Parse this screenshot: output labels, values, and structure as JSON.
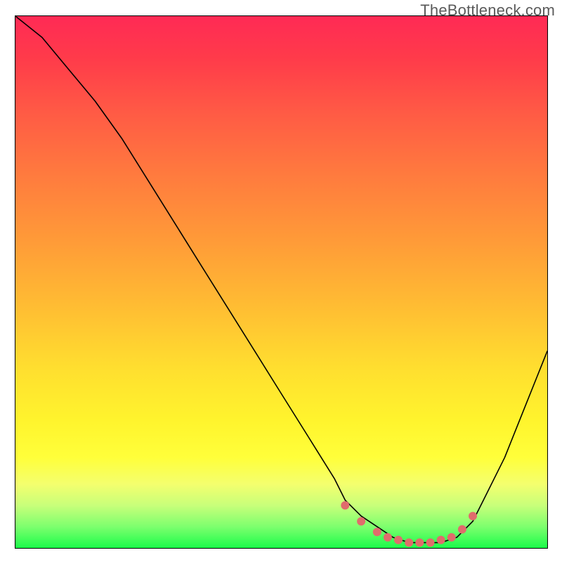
{
  "watermark": "TheBottleneck.com",
  "chart_data": {
    "type": "line",
    "title": "",
    "xlabel": "",
    "ylabel": "",
    "xlim": [
      0,
      100
    ],
    "ylim": [
      0,
      100
    ],
    "grid": false,
    "series": [
      {
        "name": "bottleneck-curve",
        "x": [
          0,
          5,
          10,
          15,
          20,
          25,
          30,
          35,
          40,
          45,
          50,
          55,
          60,
          62,
          65,
          68,
          71,
          74,
          77,
          80,
          83,
          86,
          88,
          92,
          96,
          100
        ],
        "y": [
          100,
          96,
          90,
          84,
          77,
          69,
          61,
          53,
          45,
          37,
          29,
          21,
          13,
          9,
          6,
          4,
          2,
          1,
          1,
          1,
          2,
          5,
          9,
          17,
          27,
          37
        ],
        "color": "#000000"
      }
    ],
    "markers": {
      "name": "optimal-zone-dots",
      "color": "#e06c6c",
      "x": [
        62,
        65,
        68,
        70,
        72,
        74,
        76,
        78,
        80,
        82,
        84,
        86
      ],
      "y": [
        8,
        5,
        3,
        2,
        1.5,
        1,
        1,
        1,
        1.5,
        2,
        3.5,
        6
      ]
    },
    "background_gradient": {
      "direction": "vertical",
      "stops": [
        {
          "pos": 0.0,
          "color": "#ff2a55"
        },
        {
          "pos": 0.3,
          "color": "#ff7b3e"
        },
        {
          "pos": 0.66,
          "color": "#ffde2f"
        },
        {
          "pos": 0.83,
          "color": "#ffff3a"
        },
        {
          "pos": 1.0,
          "color": "#1bfc4a"
        }
      ]
    }
  }
}
